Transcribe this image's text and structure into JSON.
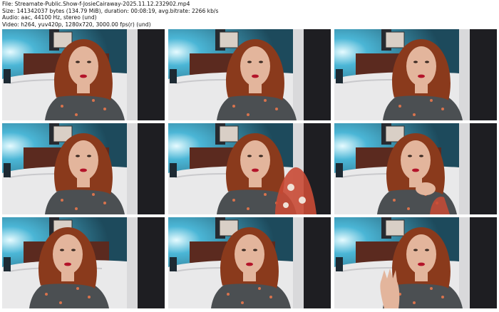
{
  "header": {
    "file": "File: Streamate-Public.Show-f-JosieCairaway-2025.11.12.232902.mp4",
    "size": "Size: 141342037 bytes (134.79 MiB), duration: 00:08:19, avg.bitrate: 2266 kb/s",
    "audio": "Audio: aac, 44100 Hz, stereo (und)",
    "video": "Video: h264, yuv420p, 1280x720, 3000.00 fps(r) (und)"
  },
  "thumbnails": [
    {
      "name": "frame-1",
      "variant": "center"
    },
    {
      "name": "frame-2",
      "variant": "right"
    },
    {
      "name": "frame-3",
      "variant": "right"
    },
    {
      "name": "frame-4",
      "variant": "center"
    },
    {
      "name": "frame-5",
      "variant": "right-arm"
    },
    {
      "name": "frame-6",
      "variant": "hand-chin"
    },
    {
      "name": "frame-7",
      "variant": "tilt-left"
    },
    {
      "name": "frame-8",
      "variant": "center"
    },
    {
      "name": "frame-9",
      "variant": "wave"
    }
  ],
  "colors": {
    "wall": "#1d4a5c",
    "wall_light": "#4bb6d6",
    "headboard": "#5b2a1f",
    "bed": "#e9e9ea",
    "hair": "#8a3a1c",
    "skin": "#e3b59c",
    "top": "#4b4f52",
    "lips": "#b3142a",
    "floral": "#c94a35"
  }
}
